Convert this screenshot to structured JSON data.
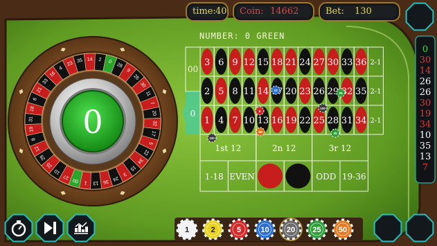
{
  "hud": {
    "time_label": "time:",
    "time_value": "40",
    "coin_label": "Coin:",
    "coin_value": "14662",
    "bet_label": "Bet:",
    "bet_value": "130"
  },
  "number_line": "NUMBER:  0 GREEN",
  "wheel": {
    "result": "0",
    "pockets": [
      "0",
      "28",
      "9",
      "26",
      "30",
      "11",
      "7",
      "20",
      "32",
      "17",
      "5",
      "22",
      "34",
      "15",
      "3",
      "24",
      "36",
      "13",
      "1",
      "00",
      "27",
      "10",
      "25",
      "29",
      "12",
      "8",
      "19",
      "31",
      "18",
      "6",
      "21",
      "33",
      "16",
      "4",
      "23",
      "35",
      "14",
      "2"
    ]
  },
  "table": {
    "zero": "0",
    "double_zero": "00",
    "rows": [
      [
        "3",
        "6",
        "9",
        "12",
        "15",
        "18",
        "21",
        "24",
        "27",
        "30",
        "33",
        "36"
      ],
      [
        "2",
        "5",
        "8",
        "11",
        "14",
        "17",
        "20",
        "23",
        "26",
        "29",
        "32",
        "35"
      ],
      [
        "1",
        "4",
        "7",
        "10",
        "13",
        "16",
        "19",
        "22",
        "25",
        "28",
        "31",
        "34"
      ]
    ],
    "column_bets": [
      "2-1",
      "2-1",
      "2-1"
    ],
    "dozens": [
      "1st 12",
      "2n 12",
      "3r 12"
    ],
    "outside": [
      "1-18",
      "EVEN",
      "ODD",
      "19-36"
    ],
    "red_numbers": [
      "1",
      "3",
      "5",
      "7",
      "9",
      "12",
      "14",
      "16",
      "18",
      "19",
      "21",
      "23",
      "25",
      "27",
      "30",
      "32",
      "34",
      "36"
    ]
  },
  "placed_chips": [
    {
      "label": "10",
      "color": "#2d6fcf"
    },
    {
      "label": "25",
      "color": "#2f9e3a"
    },
    {
      "label": "5",
      "color": "#cc2a2a"
    },
    {
      "label": "50",
      "color": "#d9741f"
    },
    {
      "label": "100",
      "color": "#3a3a3a"
    },
    {
      "label": "100",
      "color": "#3a3a3a"
    },
    {
      "label": "25",
      "color": "#2f9e3a"
    }
  ],
  "history": [
    "0",
    "30",
    "14",
    "26",
    "26",
    "30",
    "19",
    "34",
    "10",
    "35",
    "13",
    "7"
  ],
  "chips": [
    {
      "label": "1",
      "color": "#f2f2f2",
      "text": "#222222"
    },
    {
      "label": "2",
      "color": "#e8d21e",
      "text": "#222222"
    },
    {
      "label": "5",
      "color": "#d32a2a",
      "text": "#ffffff"
    },
    {
      "label": "10",
      "color": "#2d6fcf",
      "text": "#ffffff"
    },
    {
      "label": "20",
      "color": "#6b6b6b",
      "text": "#ffffff"
    },
    {
      "label": "25",
      "color": "#2f9e3a",
      "text": "#ffffff"
    },
    {
      "label": "50",
      "color": "#e07a22",
      "text": "#ffffff"
    }
  ],
  "buttons": {
    "left": [
      "timer-icon",
      "play-pause-icon",
      "stats-icon"
    ]
  },
  "colors": {
    "felt": "#6aa02c",
    "red": "#c81d1d",
    "black": "#111111",
    "green": "#2aa52a",
    "accent": "#22c6c6"
  }
}
